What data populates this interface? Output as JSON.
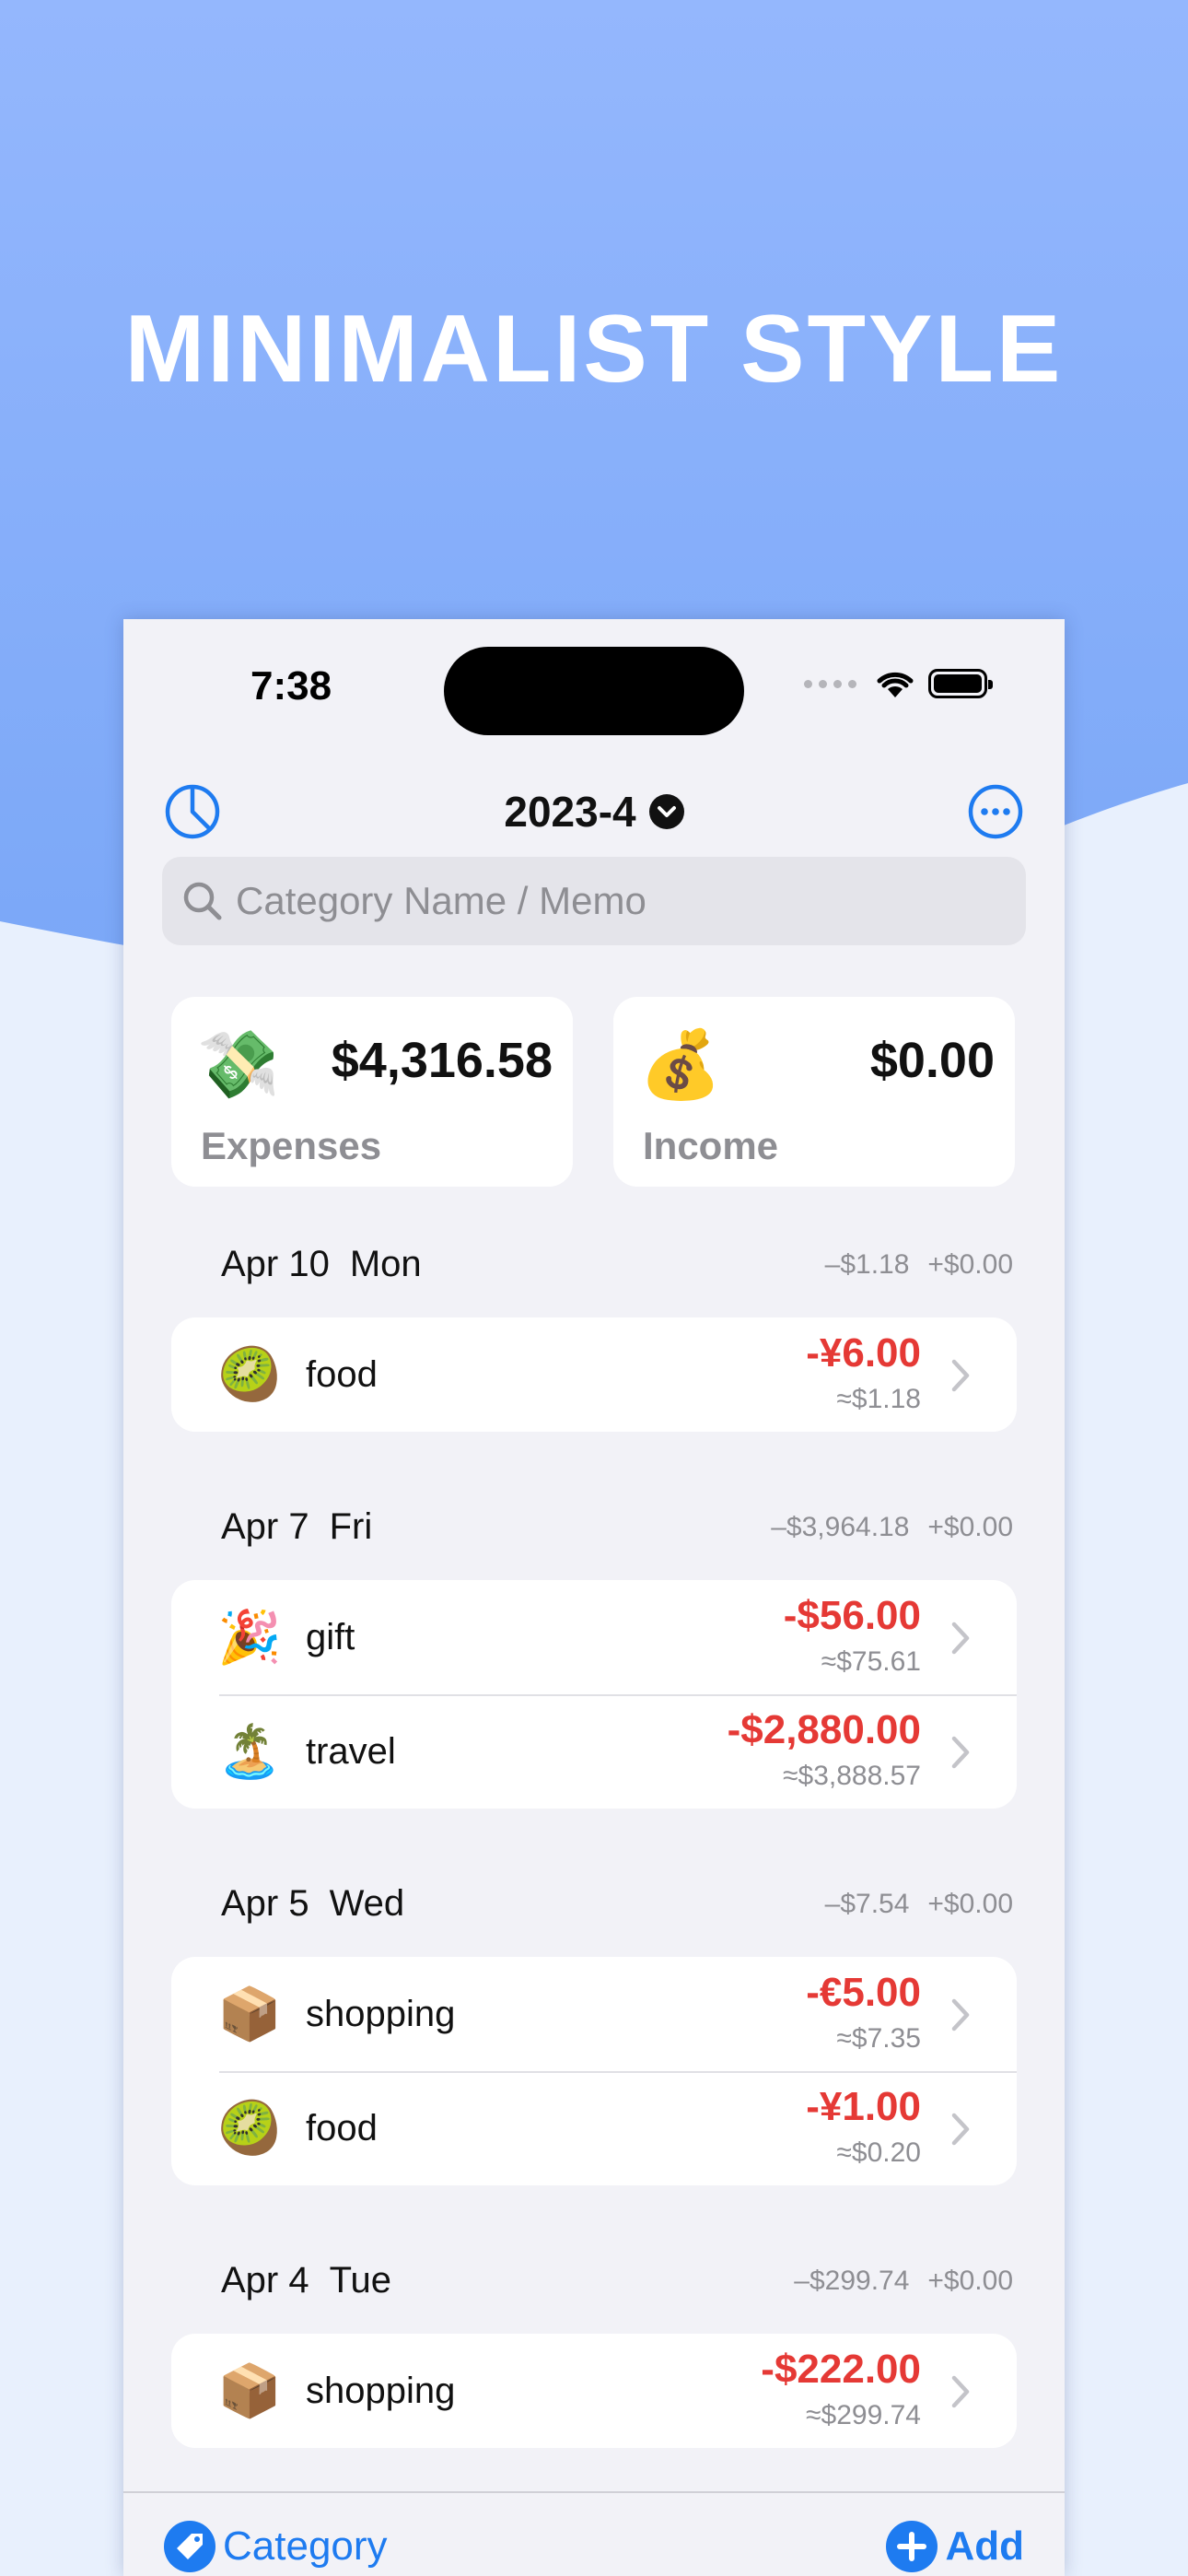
{
  "headline": "MINIMALIST STYLE",
  "colors": {
    "accent": "#1e7bf0",
    "expense": "#e53935",
    "bg_top": "#94b7fd",
    "bg_bottom": "#e8f0fd"
  },
  "status_bar": {
    "time": "7:38"
  },
  "nav": {
    "title": "2023-4",
    "left_icon": "pie-chart-icon",
    "right_icon": "more-icon",
    "title_icon": "chevron-down-icon"
  },
  "search": {
    "placeholder": "Category Name / Memo"
  },
  "summary": {
    "expenses": {
      "emoji": "💸",
      "amount": "$4,316.58",
      "label": "Expenses"
    },
    "income": {
      "emoji": "💰",
      "amount": "$0.00",
      "label": "Income"
    }
  },
  "days": [
    {
      "date": "Apr 10",
      "dow": "Mon",
      "out": "–$1.18",
      "in": "+$0.00",
      "entries": [
        {
          "emoji": "🥝",
          "name": "food",
          "amount": "-¥6.00",
          "converted": "≈$1.18"
        }
      ]
    },
    {
      "date": "Apr 7",
      "dow": "Fri",
      "out": "–$3,964.18",
      "in": "+$0.00",
      "entries": [
        {
          "emoji": "🎉",
          "name": "gift",
          "amount": "-$56.00",
          "converted": "≈$75.61"
        },
        {
          "emoji": "🏝️",
          "name": "travel",
          "amount": "-$2,880.00",
          "converted": "≈$3,888.57"
        }
      ]
    },
    {
      "date": "Apr 5",
      "dow": "Wed",
      "out": "–$7.54",
      "in": "+$0.00",
      "entries": [
        {
          "emoji": "📦",
          "name": "shopping",
          "amount": "-€5.00",
          "converted": "≈$7.35"
        },
        {
          "emoji": "🥝",
          "name": "food",
          "amount": "-¥1.00",
          "converted": "≈$0.20"
        }
      ]
    },
    {
      "date": "Apr 4",
      "dow": "Tue",
      "out": "–$299.74",
      "in": "+$0.00",
      "entries": [
        {
          "emoji": "📦",
          "name": "shopping",
          "amount": "-$222.00",
          "converted": "≈$299.74"
        }
      ]
    }
  ],
  "toolbar": {
    "category_label": "Category",
    "add_label": "Add"
  }
}
